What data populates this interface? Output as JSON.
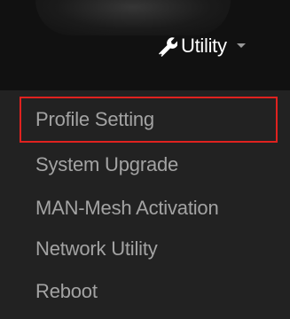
{
  "nav": {
    "utility_label": "Utility",
    "wrench_icon": "wrench-icon",
    "caret_icon": "caret-down-icon"
  },
  "dropdown": {
    "items": [
      {
        "label": "Profile Setting",
        "highlighted": true
      },
      {
        "label": "System Upgrade",
        "highlighted": false
      },
      {
        "label": "MAN-Mesh Activation",
        "highlighted": false
      },
      {
        "label": "Network Utility",
        "highlighted": false
      },
      {
        "label": "Reboot",
        "highlighted": false
      }
    ]
  },
  "colors": {
    "navbar_bg": "#111111",
    "menu_bg": "#222222",
    "menu_text": "#a3a3a3",
    "highlight_border": "#e0221f"
  }
}
